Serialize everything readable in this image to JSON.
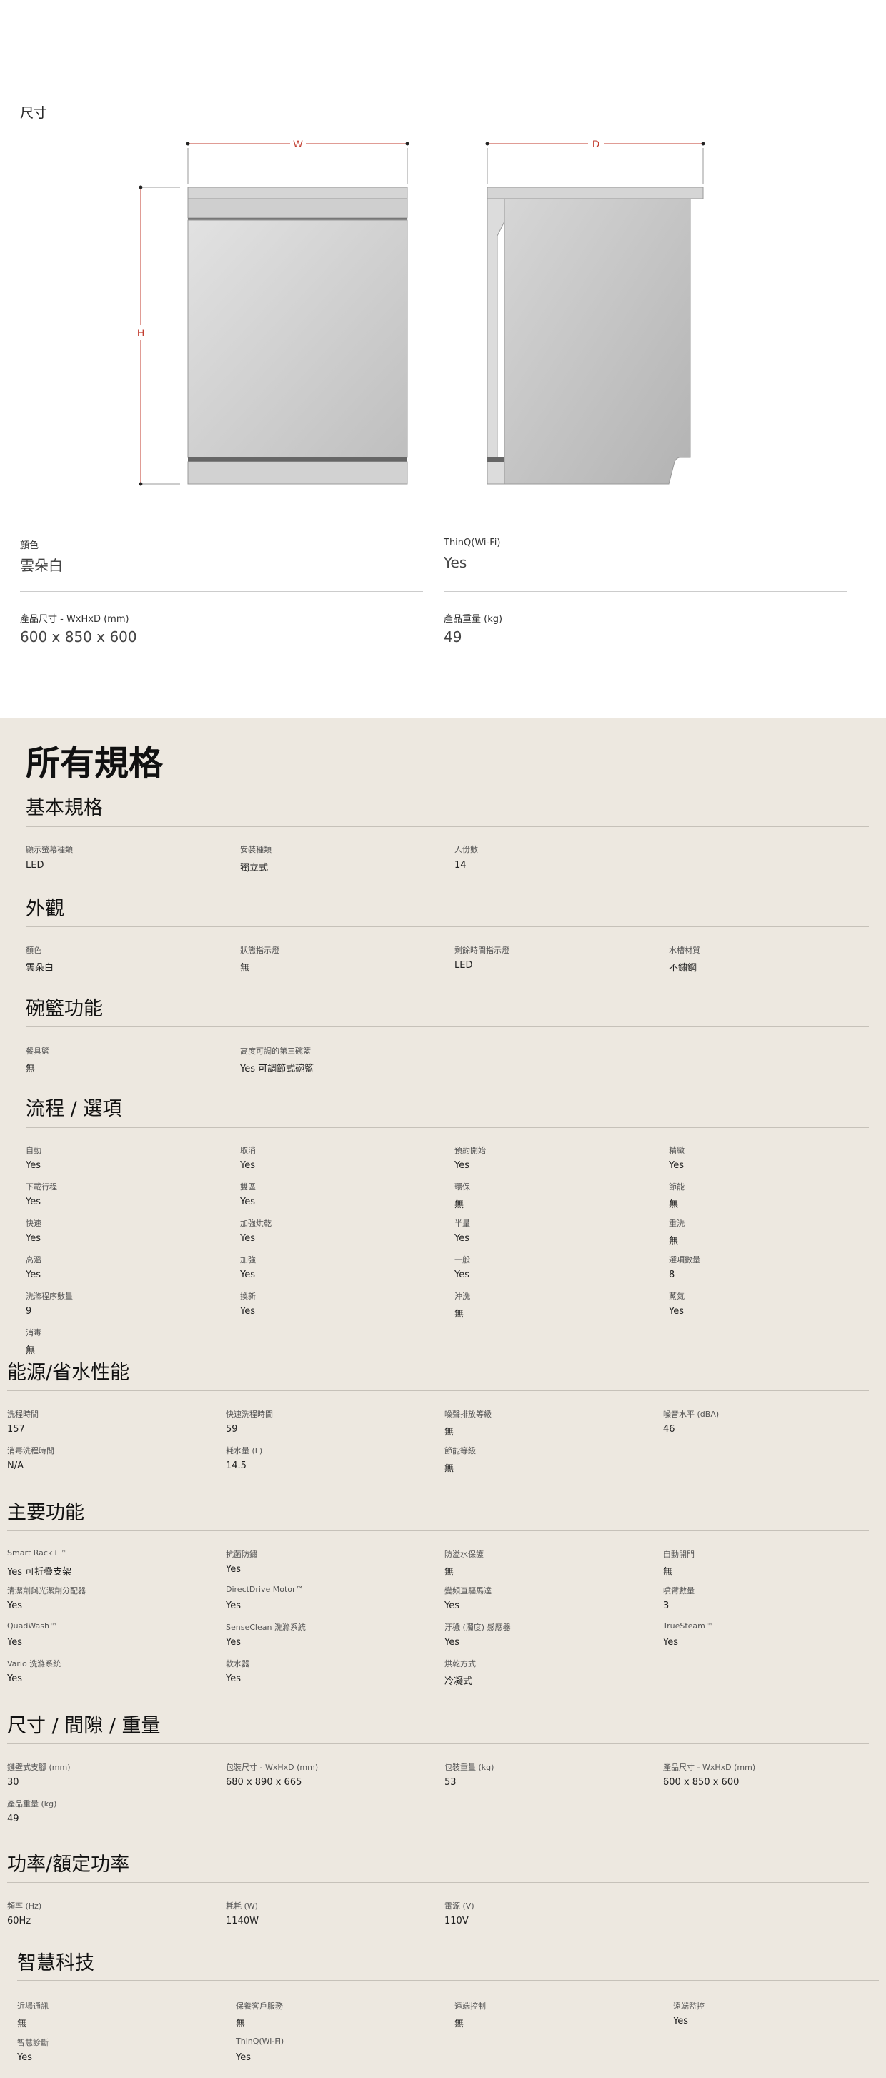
{
  "dimension": {
    "title": "尺寸",
    "w_label": "W",
    "d_label": "D",
    "h_label": "H"
  },
  "top_specs": [
    {
      "label": "顏色",
      "value": "雲朵白"
    },
    {
      "label": "ThinQ(Wi-Fi)",
      "value": "Yes"
    },
    {
      "label": "產品尺寸 - WxHxD (mm)",
      "value": "600 x 850 x 600"
    },
    {
      "label": "產品重量 (kg)",
      "value": "49"
    }
  ],
  "all_specs_title": "所有規格",
  "sections": [
    {
      "title": "基本規格",
      "items": [
        {
          "label": "顯示螢幕種類",
          "value": "LED"
        },
        {
          "label": "安裝種類",
          "value": "獨立式"
        },
        {
          "label": "人份數",
          "value": "14"
        }
      ]
    },
    {
      "title": "外觀",
      "items": [
        {
          "label": "顏色",
          "value": "雲朵白"
        },
        {
          "label": "狀態指示燈",
          "value": "無"
        },
        {
          "label": "剩餘時間指示燈",
          "value": "LED"
        },
        {
          "label": "水槽材質",
          "value": "不鏽鋼"
        }
      ]
    },
    {
      "title": "碗籃功能",
      "items": [
        {
          "label": "餐具籃",
          "value": "無"
        },
        {
          "label": "高度可調的第三碗籃",
          "value": "Yes 可調節式碗籃"
        }
      ]
    },
    {
      "title": "流程 / 選項",
      "items": [
        {
          "label": "自動",
          "value": "Yes"
        },
        {
          "label": "取消",
          "value": "Yes"
        },
        {
          "label": "預約開始",
          "value": "Yes"
        },
        {
          "label": "精緻",
          "value": "Yes"
        },
        {
          "label": "下載行程",
          "value": "Yes"
        },
        {
          "label": "雙區",
          "value": "Yes"
        },
        {
          "label": "環保",
          "value": "無"
        },
        {
          "label": "節能",
          "value": "無"
        },
        {
          "label": "快速",
          "value": "Yes"
        },
        {
          "label": "加強烘乾",
          "value": "Yes"
        },
        {
          "label": "半量",
          "value": "Yes"
        },
        {
          "label": "重洗",
          "value": "無"
        },
        {
          "label": "高溫",
          "value": "Yes"
        },
        {
          "label": "加強",
          "value": "Yes"
        },
        {
          "label": "一般",
          "value": "Yes"
        },
        {
          "label": "選項數量",
          "value": "8"
        },
        {
          "label": "洗滌程序數量",
          "value": "9"
        },
        {
          "label": "換新",
          "value": "Yes"
        },
        {
          "label": "沖洗",
          "value": "無"
        },
        {
          "label": "蒸氣",
          "value": "Yes"
        },
        {
          "label": "消毒",
          "value": "無"
        }
      ]
    },
    {
      "title": "能源/省水性能",
      "items": [
        {
          "label": "洗程時間",
          "value": "157"
        },
        {
          "label": "快速洗程時間",
          "value": "59"
        },
        {
          "label": "噪聲排放等級",
          "value": "無"
        },
        {
          "label": "噪音水平 (dBA)",
          "value": "46"
        },
        {
          "label": "消毒洗程時間",
          "value": "N/A"
        },
        {
          "label": "耗水量 (L)",
          "value": "14.5"
        },
        {
          "label": "節能等級",
          "value": "無"
        }
      ]
    },
    {
      "title": "主要功能",
      "items": [
        {
          "label": "Smart Rack+™",
          "value": "Yes 可折疊支架"
        },
        {
          "label": "抗菌防鏽",
          "value": "Yes"
        },
        {
          "label": "防溢水保護",
          "value": "無"
        },
        {
          "label": "自動開門",
          "value": "無"
        },
        {
          "label": "清潔劑與光潔劑分配器",
          "value": "Yes"
        },
        {
          "label": "DirectDrive Motor™",
          "value": "Yes"
        },
        {
          "label": "變頻直驅馬達",
          "value": "Yes"
        },
        {
          "label": "噴臂數量",
          "value": "3"
        },
        {
          "label": "QuadWash™",
          "value": "Yes"
        },
        {
          "label": "SenseClean 洗滌系統",
          "value": "Yes"
        },
        {
          "label": "汙穢 (濁度) 感應器",
          "value": "Yes"
        },
        {
          "label": "TrueSteam™",
          "value": "Yes"
        },
        {
          "label": "Vario 洗滌系統",
          "value": "Yes"
        },
        {
          "label": "軟水器",
          "value": "Yes"
        },
        {
          "label": "烘乾方式",
          "value": "冷凝式"
        }
      ]
    },
    {
      "title": "尺寸 / 間隙 / 重量",
      "items": [
        {
          "label": "鏈壁式支腳 (mm)",
          "value": "30"
        },
        {
          "label": "包裝尺寸 - WxHxD (mm)",
          "value": "680 x 890 x 665"
        },
        {
          "label": "包裝重量 (kg)",
          "value": "53"
        },
        {
          "label": "產品尺寸 - WxHxD (mm)",
          "value": "600 x 850 x 600"
        },
        {
          "label": "產品重量 (kg)",
          "value": "49"
        }
      ]
    },
    {
      "title": "功率/額定功率",
      "items": [
        {
          "label": "頻率 (Hz)",
          "value": "60Hz"
        },
        {
          "label": "耗耗 (W)",
          "value": "1140W"
        },
        {
          "label": "電源 (V)",
          "value": "110V"
        }
      ]
    },
    {
      "title": "智慧科技",
      "items": [
        {
          "label": "近場通訊",
          "value": "無"
        },
        {
          "label": "保養客戶服務",
          "value": "無"
        },
        {
          "label": "遠端控制",
          "value": "無"
        },
        {
          "label": "遠端監控",
          "value": "Yes"
        },
        {
          "label": "智慧診斷",
          "value": "Yes"
        },
        {
          "label": "ThinQ(Wi-Fi)",
          "value": "Yes"
        }
      ]
    }
  ]
}
